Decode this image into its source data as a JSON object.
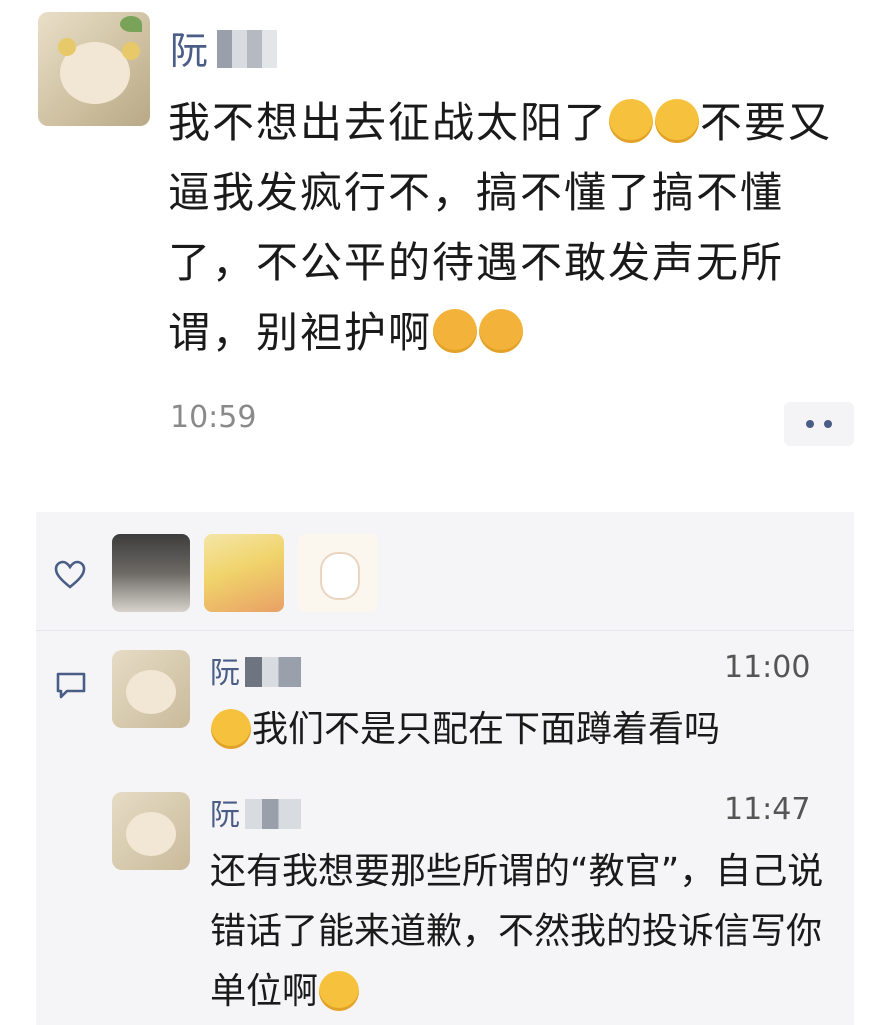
{
  "post": {
    "author_visible": "阮",
    "text_parts": [
      "我不想出去征战太阳了",
      "不要又逼我发疯行不，搞不懂了搞不懂了，不公平的待遇不敢发声无所谓，别袒护啊"
    ],
    "emoji_1": "thinking-face",
    "emoji_2": "sad-face",
    "time": "10:59"
  },
  "likes": {
    "icon": "heart-icon",
    "avatars": [
      "person-avatar",
      "pikachu-avatar",
      "bunny-avatar"
    ]
  },
  "comments": [
    {
      "author_visible": "阮",
      "time": "11:00",
      "emoji": "sweat-face",
      "text": "我们不是只配在下面蹲着看吗"
    },
    {
      "author_visible": "阮",
      "time": "11:47",
      "text": "还有我想要那些所谓的“教官”，自己说错话了能来道歉，不然我的投诉信写你单位啊",
      "emoji": "sweat-face"
    }
  ],
  "colors": {
    "name_color": "#4a5d86",
    "panel_bg": "#f5f5f7",
    "emoji_yellow": "#f6c23e"
  }
}
